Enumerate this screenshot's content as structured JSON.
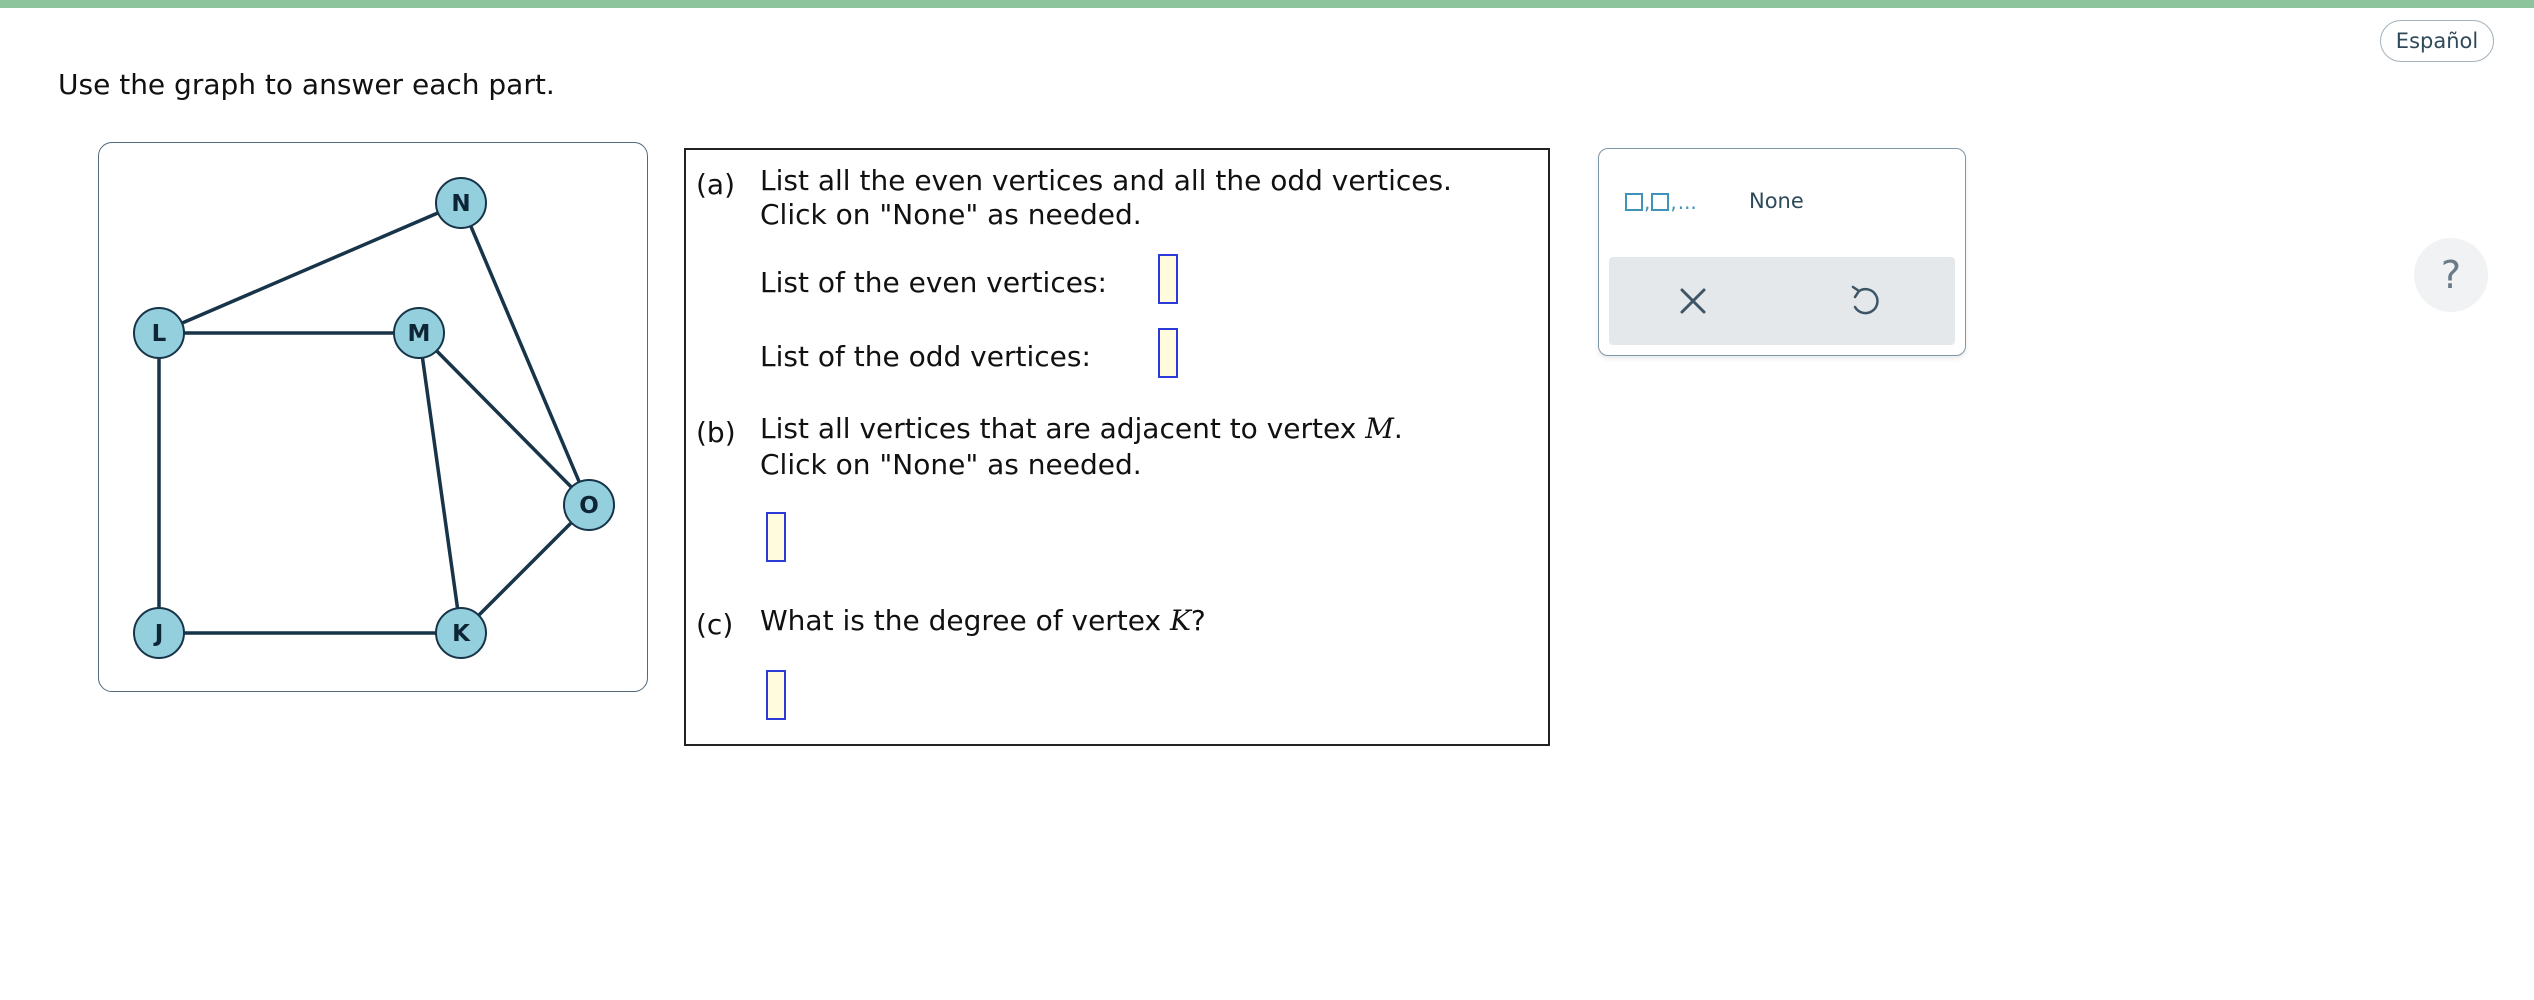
{
  "header": {
    "language_button": "Español",
    "accent_color": "#8dc49b"
  },
  "prompt": "Use the graph to answer each part.",
  "graph": {
    "vertices": [
      {
        "label": "N"
      },
      {
        "label": "L"
      },
      {
        "label": "M"
      },
      {
        "label": "O"
      },
      {
        "label": "J"
      },
      {
        "label": "K"
      }
    ],
    "edges": [
      [
        "L",
        "N"
      ],
      [
        "N",
        "O"
      ],
      [
        "L",
        "M"
      ],
      [
        "M",
        "O"
      ],
      [
        "M",
        "K"
      ],
      [
        "L",
        "J"
      ],
      [
        "J",
        "K"
      ],
      [
        "K",
        "O"
      ]
    ],
    "vertex_fill": "#93cfdd",
    "edge_color": "#173449"
  },
  "questions": {
    "a": {
      "marker": "(a)",
      "line1": "List all the even vertices and all the odd vertices.",
      "line2": "Click on \"None\" as needed.",
      "even_label": "List of the even vertices:",
      "odd_label": "List of the odd vertices:"
    },
    "b": {
      "marker": "(b)",
      "line1_prefix": "List all vertices that are adjacent to vertex ",
      "vertex": "M",
      "line1_suffix": ".",
      "line2": "Click on \"None\" as needed."
    },
    "c": {
      "marker": "(c)",
      "prefix": "What is the degree of vertex ",
      "vertex": "K",
      "suffix": "?"
    }
  },
  "toolbox": {
    "list_tool_icon": "list-template-icon",
    "list_tool_comma": ",",
    "list_tool_dots": "...",
    "none_label": "None",
    "clear_icon": "close-icon",
    "undo_icon": "undo-icon"
  },
  "help": {
    "label": "?"
  }
}
